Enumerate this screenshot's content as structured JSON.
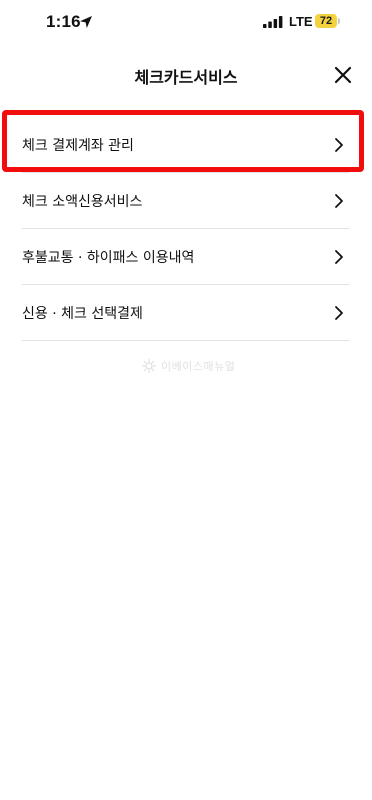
{
  "status_bar": {
    "time": "1:16",
    "network": "LTE",
    "battery": "72",
    "icons": {
      "location": "location-arrow-icon",
      "signal": "signal-bars-icon"
    }
  },
  "header": {
    "title": "체크카드서비스",
    "close_icon": "close-icon"
  },
  "menu": {
    "items": [
      {
        "label": "체크 결제계좌 관리"
      },
      {
        "label": "체크 소액신용서비스"
      },
      {
        "label": "후불교통 · 하이패스 이용내역"
      },
      {
        "label": "신용 · 체크 선택결제"
      }
    ],
    "highlighted_index": 0,
    "highlight_color": "#f20d0d"
  },
  "watermark": {
    "text": "이베이스매뉴얼"
  },
  "colors": {
    "battery": "#f4d23c",
    "divider": "#e3e3e3",
    "text": "#111111"
  }
}
